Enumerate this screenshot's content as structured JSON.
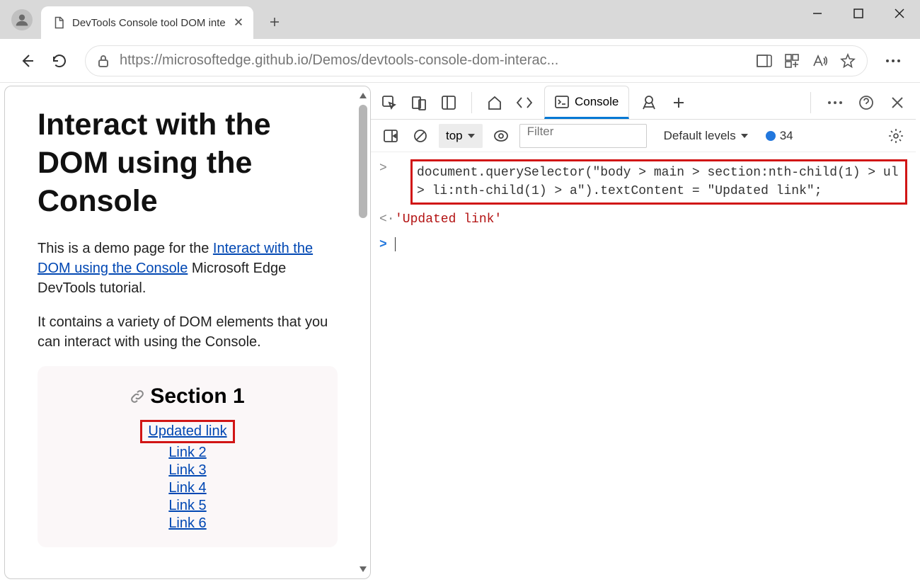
{
  "window": {
    "tab_title": "DevTools Console tool DOM inte",
    "url": "https://microsoftedge.github.io/Demos/devtools-console-dom-interac..."
  },
  "page": {
    "h1": "Interact with the DOM using the Console",
    "p1_pre": "This is a demo page for the ",
    "p1_link": "Interact with the DOM using the Console",
    "p1_post": " Microsoft Edge DevTools tutorial.",
    "p2": "It contains a variety of DOM elements that you can interact with using the Console.",
    "section_title": "Section 1",
    "links": [
      "Updated link",
      "Link 2",
      "Link 3",
      "Link 4",
      "Link 5",
      "Link 6"
    ]
  },
  "devtools": {
    "tab_console": "Console",
    "context": "top",
    "filter_placeholder": "Filter",
    "levels": "Default levels",
    "issue_count": "34",
    "code_line": "document.querySelector(\"body > main > section:nth-child(1) > ul > li:nth-child(1) > a\").textContent = \"Updated link\";",
    "output": "'Updated link'"
  }
}
